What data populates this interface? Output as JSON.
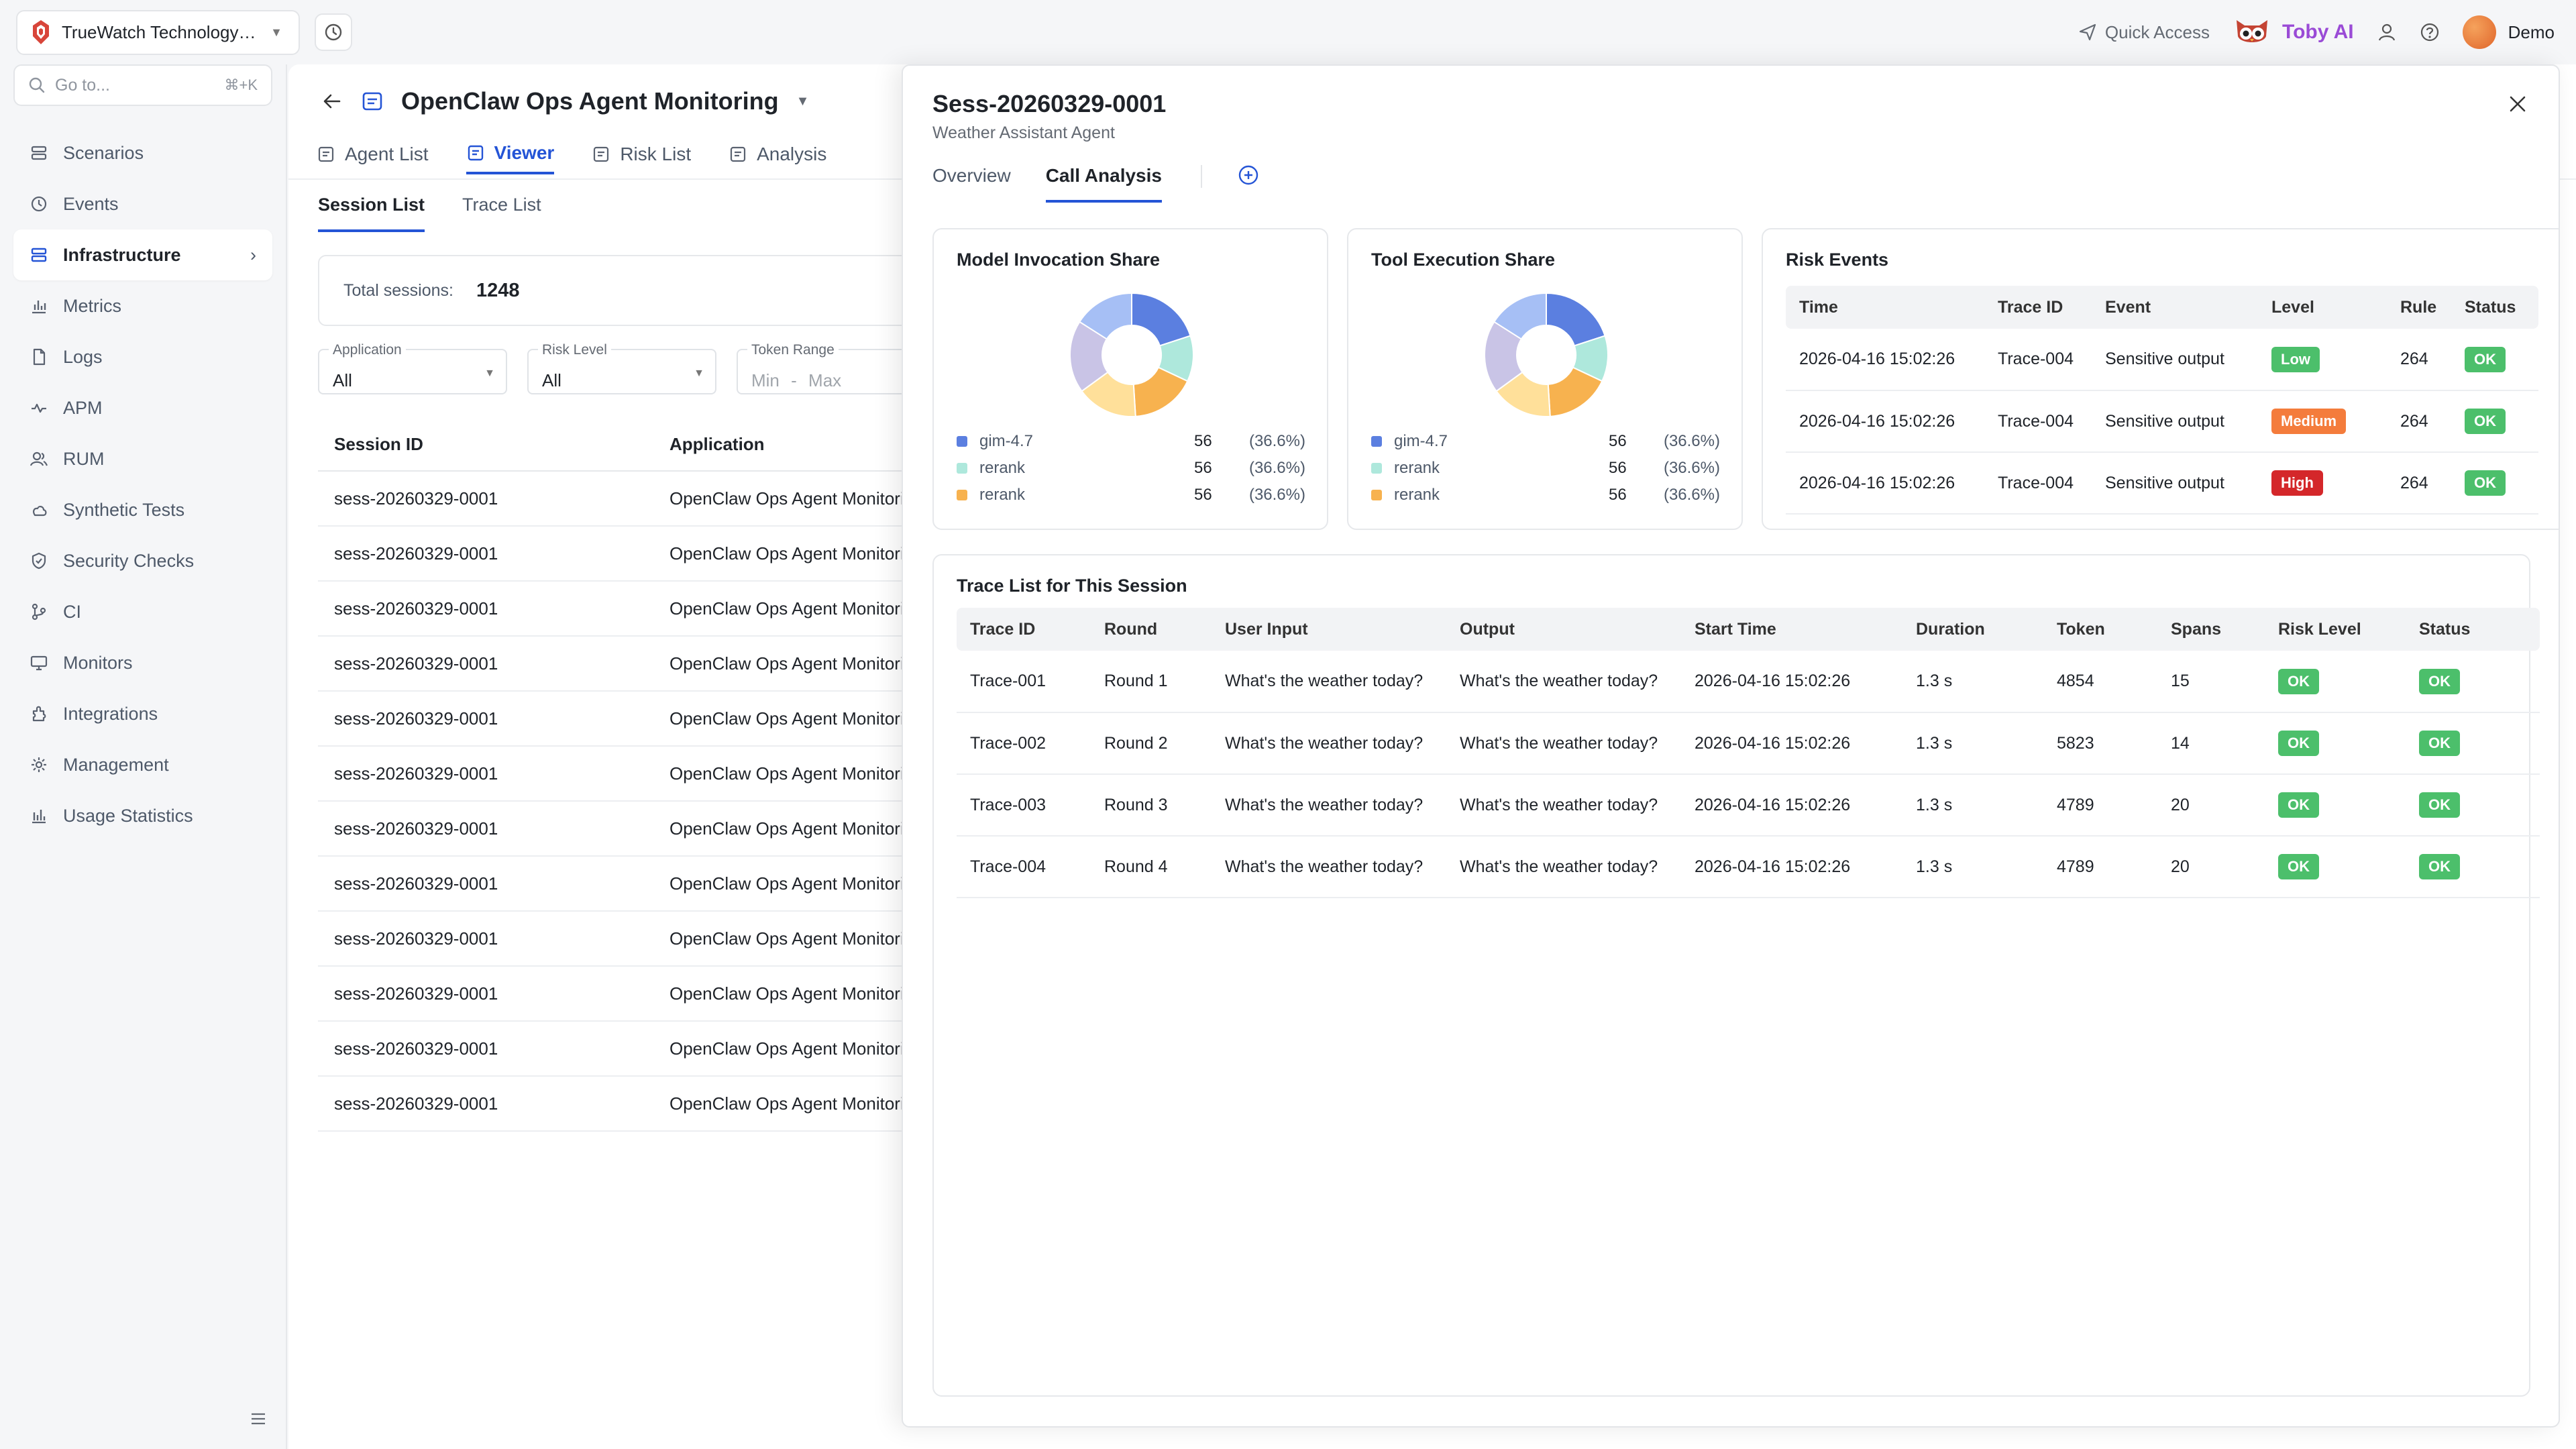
{
  "topbar": {
    "workspace": "TrueWatch Technology Co...",
    "quick_access": "Quick Access",
    "toby_label": "Toby AI",
    "user_name": "Demo"
  },
  "sidebar": {
    "search_placeholder": "Go to...",
    "search_shortcut": "⌘+K",
    "items": [
      {
        "label": "Scenarios",
        "icon": "scenarios-icon"
      },
      {
        "label": "Events",
        "icon": "events-icon"
      },
      {
        "label": "Infrastructure",
        "icon": "infrastructure-icon",
        "active": true
      },
      {
        "label": "Metrics",
        "icon": "metrics-icon"
      },
      {
        "label": "Logs",
        "icon": "logs-icon"
      },
      {
        "label": "APM",
        "icon": "apm-icon"
      },
      {
        "label": "RUM",
        "icon": "rum-icon"
      },
      {
        "label": "Synthetic Tests",
        "icon": "synthetic-tests-icon"
      },
      {
        "label": "Security Checks",
        "icon": "security-checks-icon"
      },
      {
        "label": "CI",
        "icon": "ci-icon"
      },
      {
        "label": "Monitors",
        "icon": "monitors-icon"
      },
      {
        "label": "Integrations",
        "icon": "integrations-icon"
      },
      {
        "label": "Management",
        "icon": "management-icon"
      },
      {
        "label": "Usage Statistics",
        "icon": "usage-statistics-icon"
      }
    ]
  },
  "main": {
    "title": "OpenClaw Ops Agent Monitoring",
    "tabs": [
      "Agent List",
      "Viewer",
      "Risk List",
      "Analysis"
    ],
    "active_tab": "Viewer",
    "subtabs": [
      "Session List",
      "Trace List"
    ],
    "active_subtab": "Session List",
    "total_label": "Total sessions:",
    "total_value": "1248",
    "filters": {
      "application": {
        "label": "Application",
        "value": "All"
      },
      "risk_level": {
        "label": "Risk Level",
        "value": "All"
      },
      "token_range": {
        "label": "Token Range",
        "min": "Min",
        "sep": "-",
        "max": "Max"
      }
    },
    "table": {
      "columns": [
        "Session ID",
        "Application"
      ],
      "rows": [
        [
          "sess-20260329-0001",
          "OpenClaw Ops Agent Monitoring"
        ],
        [
          "sess-20260329-0001",
          "OpenClaw Ops Agent Monitoring"
        ],
        [
          "sess-20260329-0001",
          "OpenClaw Ops Agent Monitoring"
        ],
        [
          "sess-20260329-0001",
          "OpenClaw Ops Agent Monitoring"
        ],
        [
          "sess-20260329-0001",
          "OpenClaw Ops Agent Monitoring"
        ],
        [
          "sess-20260329-0001",
          "OpenClaw Ops Agent Monitoring"
        ],
        [
          "sess-20260329-0001",
          "OpenClaw Ops Agent Monitoring"
        ],
        [
          "sess-20260329-0001",
          "OpenClaw Ops Agent Monitoring"
        ],
        [
          "sess-20260329-0001",
          "OpenClaw Ops Agent Monitoring"
        ],
        [
          "sess-20260329-0001",
          "OpenClaw Ops Agent Monitoring"
        ],
        [
          "sess-20260329-0001",
          "OpenClaw Ops Agent Monitoring"
        ],
        [
          "sess-20260329-0001",
          "OpenClaw Ops Agent Monitoring"
        ]
      ]
    }
  },
  "drawer": {
    "title": "Sess-20260329-0001",
    "subtitle": "Weather Assistant Agent",
    "tabs": [
      "Overview",
      "Call Analysis"
    ],
    "active_tab": "Call Analysis",
    "model_card_title": "Model Invocation Share",
    "tool_card_title": "Tool Execution Share",
    "risk_card_title": "Risk Events",
    "trace_card_title": "Trace List for This Session",
    "risk_table": {
      "columns": [
        "Time",
        "Trace ID",
        "Event",
        "Level",
        "Rule",
        "Status"
      ],
      "rows": [
        {
          "time": "2026-04-16 15:02:26",
          "trace": "Trace-004",
          "event": "Sensitive output",
          "level": "Low",
          "level_color": "#4cbf6b",
          "rule": "264",
          "status": "OK"
        },
        {
          "time": "2026-04-16 15:02:26",
          "trace": "Trace-004",
          "event": "Sensitive output",
          "level": "Medium",
          "level_color": "#f47c3c",
          "rule": "264",
          "status": "OK"
        },
        {
          "time": "2026-04-16 15:02:26",
          "trace": "Trace-004",
          "event": "Sensitive output",
          "level": "High",
          "level_color": "#d4272a",
          "rule": "264",
          "status": "OK"
        }
      ]
    },
    "trace_table": {
      "columns": [
        "Trace ID",
        "Round",
        "User Input",
        "Output",
        "Start Time",
        "Duration",
        "Token",
        "Spans",
        "Risk Level",
        "Status"
      ],
      "rows": [
        {
          "id": "Trace-001",
          "round": "Round 1",
          "input": "What's the weather today?",
          "output": "What's the weather today?",
          "start": "2026-04-16 15:02:26",
          "duration": "1.3 s",
          "token": "4854",
          "spans": "15",
          "risk": "OK",
          "status": "OK"
        },
        {
          "id": "Trace-002",
          "round": "Round 2",
          "input": "What's the weather today?",
          "output": "What's the weather today?",
          "start": "2026-04-16 15:02:26",
          "duration": "1.3 s",
          "token": "5823",
          "spans": "14",
          "risk": "OK",
          "status": "OK"
        },
        {
          "id": "Trace-003",
          "round": "Round 3",
          "input": "What's the weather today?",
          "output": "What's the weather today?",
          "start": "2026-04-16 15:02:26",
          "duration": "1.3 s",
          "token": "4789",
          "spans": "20",
          "risk": "OK",
          "status": "OK"
        },
        {
          "id": "Trace-004",
          "round": "Round 4",
          "input": "What's the weather today?",
          "output": "What's the weather today?",
          "start": "2026-04-16 15:02:26",
          "duration": "1.3 s",
          "token": "4789",
          "spans": "20",
          "risk": "OK",
          "status": "OK"
        }
      ]
    }
  },
  "colors": {
    "accent": "#2454d6",
    "ok": "#4cbf6b",
    "donut": [
      "#5b7fe0",
      "#aee8dc",
      "#f7b24f",
      "#ffe09a",
      "#c9c4e6",
      "#a6bff5"
    ]
  },
  "chart_data": [
    {
      "type": "pie",
      "title": "Model Invocation Share",
      "legend": [
        {
          "name": "gim-4.7",
          "value": 56,
          "percent": "(36.6%)",
          "color": "#5b7fe0"
        },
        {
          "name": "rerank",
          "value": 56,
          "percent": "(36.6%)",
          "color": "#aee8dc"
        },
        {
          "name": "rerank",
          "value": 56,
          "percent": "(36.6%)",
          "color": "#f7b24f"
        }
      ],
      "slices": [
        {
          "value": 20,
          "color": "#5b7fe0"
        },
        {
          "value": 12,
          "color": "#aee8dc"
        },
        {
          "value": 17,
          "color": "#f7b24f"
        },
        {
          "value": 16,
          "color": "#ffe09a"
        },
        {
          "value": 19,
          "color": "#c9c4e6"
        },
        {
          "value": 16,
          "color": "#a6bff5"
        }
      ]
    },
    {
      "type": "pie",
      "title": "Tool Execution Share",
      "legend": [
        {
          "name": "gim-4.7",
          "value": 56,
          "percent": "(36.6%)",
          "color": "#5b7fe0"
        },
        {
          "name": "rerank",
          "value": 56,
          "percent": "(36.6%)",
          "color": "#aee8dc"
        },
        {
          "name": "rerank",
          "value": 56,
          "percent": "(36.6%)",
          "color": "#f7b24f"
        }
      ],
      "slices": [
        {
          "value": 20,
          "color": "#5b7fe0"
        },
        {
          "value": 12,
          "color": "#aee8dc"
        },
        {
          "value": 17,
          "color": "#f7b24f"
        },
        {
          "value": 16,
          "color": "#ffe09a"
        },
        {
          "value": 19,
          "color": "#c9c4e6"
        },
        {
          "value": 16,
          "color": "#a6bff5"
        }
      ]
    }
  ]
}
